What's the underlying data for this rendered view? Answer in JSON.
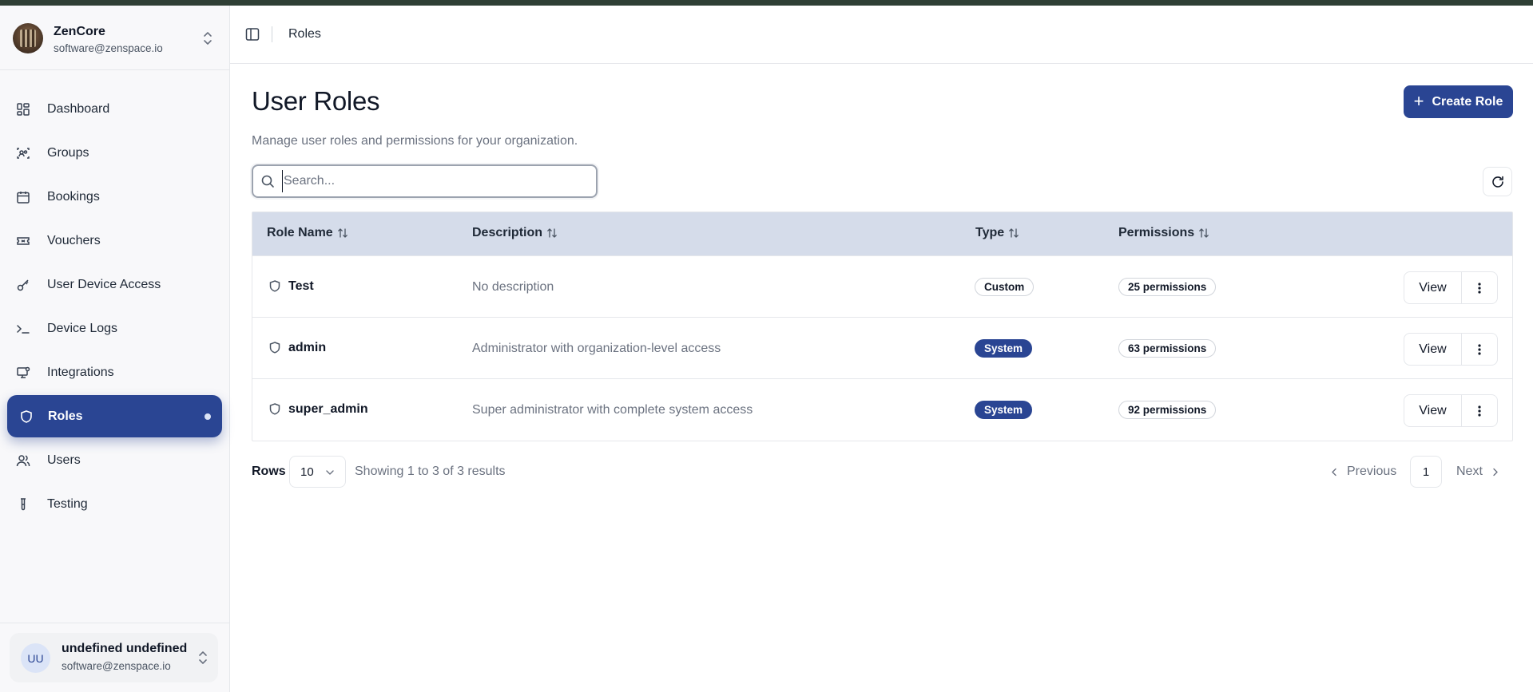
{
  "org": {
    "name": "ZenCore",
    "email": "software@zenspace.io"
  },
  "sidebar": {
    "items": [
      {
        "label": "Dashboard",
        "icon": "dashboard-icon"
      },
      {
        "label": "Groups",
        "icon": "groups-icon"
      },
      {
        "label": "Bookings",
        "icon": "calendar-icon"
      },
      {
        "label": "Vouchers",
        "icon": "ticket-icon"
      },
      {
        "label": "User Device Access",
        "icon": "key-icon"
      },
      {
        "label": "Device Logs",
        "icon": "terminal-icon"
      },
      {
        "label": "Integrations",
        "icon": "monitor-icon"
      },
      {
        "label": "Roles",
        "icon": "shield-icon",
        "active": true
      },
      {
        "label": "Users",
        "icon": "users-icon"
      },
      {
        "label": "Testing",
        "icon": "test-tube-icon"
      }
    ]
  },
  "user": {
    "initials": "UU",
    "name": "undefined undefined",
    "email": "software@zenspace.io"
  },
  "header": {
    "breadcrumb": "Roles"
  },
  "main": {
    "title": "User Roles",
    "subtitle": "Manage user roles and permissions for your organization.",
    "create_label": "Create Role",
    "search_placeholder": "Search..."
  },
  "table": {
    "columns": [
      "Role Name",
      "Description",
      "Type",
      "Permissions"
    ],
    "rows": [
      {
        "name": "Test",
        "description": "No description",
        "type": "Custom",
        "permissions": "25 permissions"
      },
      {
        "name": "admin",
        "description": "Administrator with organization-level access",
        "type": "System",
        "permissions": "63 permissions"
      },
      {
        "name": "super_admin",
        "description": "Super administrator with complete system access",
        "type": "System",
        "permissions": "92 permissions"
      }
    ],
    "view_label": "View"
  },
  "pagination": {
    "rows_label": "Rows",
    "rows_value": "10",
    "showing": "Showing 1 to 3 of 3 results",
    "previous": "Previous",
    "page": "1",
    "next": "Next"
  },
  "colors": {
    "accent": "#2a4593",
    "header_bg": "#d5dcea"
  }
}
